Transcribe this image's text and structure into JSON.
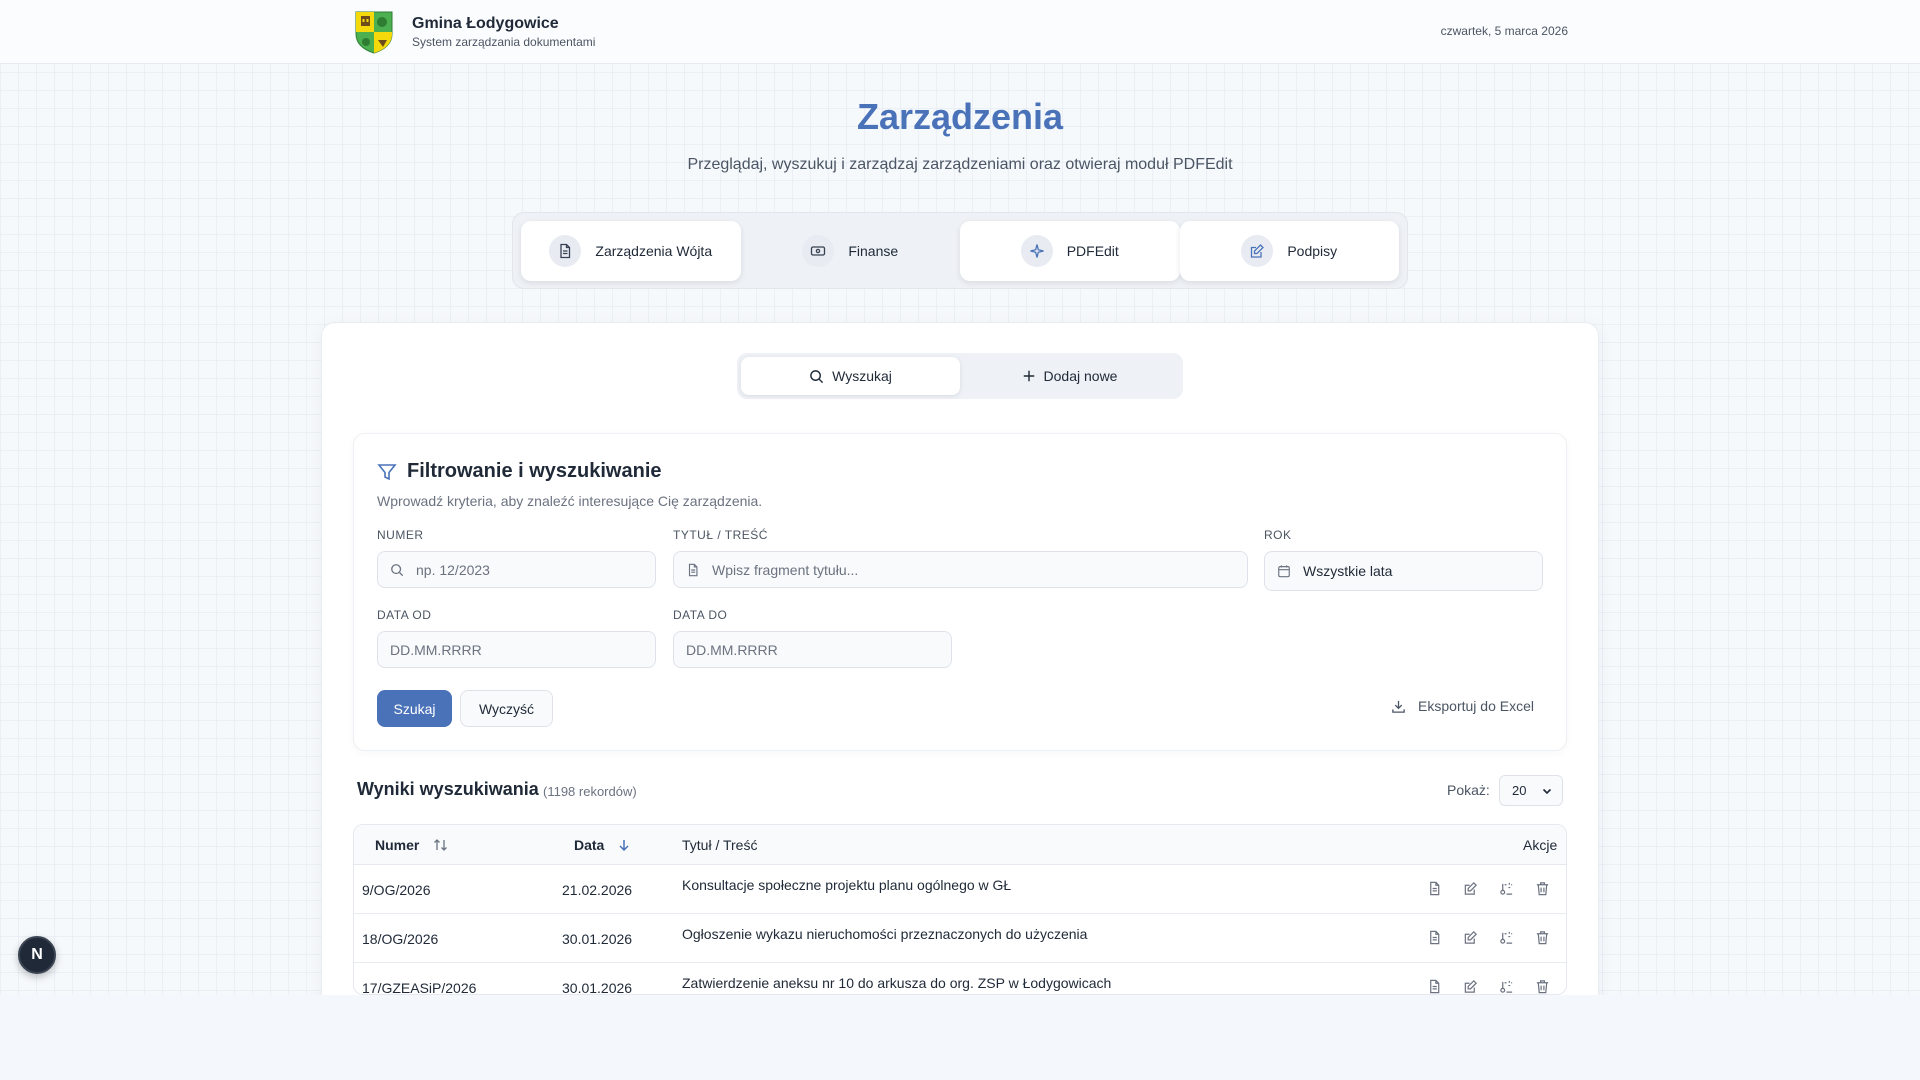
{
  "header": {
    "brand_name": "Gmina Łodygowice",
    "brand_sub": "System zarządzania dokumentami",
    "date": "czwartek, 5 marca 2026"
  },
  "hero": {
    "title": "Zarządzenia",
    "subtitle": "Przeglądaj, wyszukuj i zarządzaj zarządzeniami oraz otwieraj moduł PDFEdit"
  },
  "module_tabs": [
    {
      "label": "Zarządzenia Wójta",
      "icon": "document-icon"
    },
    {
      "label": "Finanse",
      "icon": "money-icon"
    },
    {
      "label": "PDFEdit",
      "icon": "sparkle-icon"
    },
    {
      "label": "Podpisy",
      "icon": "edit-icon"
    }
  ],
  "segment": {
    "search_label": "Wyszukaj",
    "add_label": "Dodaj nowe"
  },
  "filter": {
    "title": "Filtrowanie i wyszukiwanie",
    "description": "Wprowadź kryteria, aby znaleźć interesujące Cię zarządzenia.",
    "number_label": "NUMER",
    "number_placeholder": "np. 12/2023",
    "title_label": "TYTUŁ / TREŚĆ",
    "title_placeholder": "Wpisz fragment tytułu...",
    "year_label": "ROK",
    "year_value": "Wszystkie lata",
    "date_from_label": "DATA OD",
    "date_from_placeholder": "DD.MM.RRRR",
    "date_to_label": "DATA DO",
    "date_to_placeholder": "DD.MM.RRRR",
    "search_button": "Szukaj",
    "clear_button": "Wyczyść",
    "export_label": "Eksportuj do Excel"
  },
  "results": {
    "title": "Wyniki wyszukiwania",
    "count": "(1198 rekordów)",
    "show_label": "Pokaż:",
    "page_size": "20",
    "columns": {
      "number": "Numer",
      "date": "Data",
      "title": "Tytuł / Treść",
      "actions": "Akcje"
    },
    "rows": [
      {
        "number": "9/OG/2026",
        "date": "21.02.2026",
        "title": "Konsultacje społeczne projektu planu ogólnego w GŁ"
      },
      {
        "number": "18/OG/2026",
        "date": "30.01.2026",
        "title": "Ogłoszenie wykazu nieruchomości przeznaczonych do użyczenia"
      },
      {
        "number": "17/GZEASiP/2026",
        "date": "30.01.2026",
        "title": "Zatwierdzenie aneksu nr 10 do arkusza do org. ZSP w Łodygowicach"
      }
    ]
  },
  "fab_label": "N",
  "colors": {
    "accent": "#4a72b8",
    "text": "#1f2937",
    "muted": "#6b7280"
  }
}
